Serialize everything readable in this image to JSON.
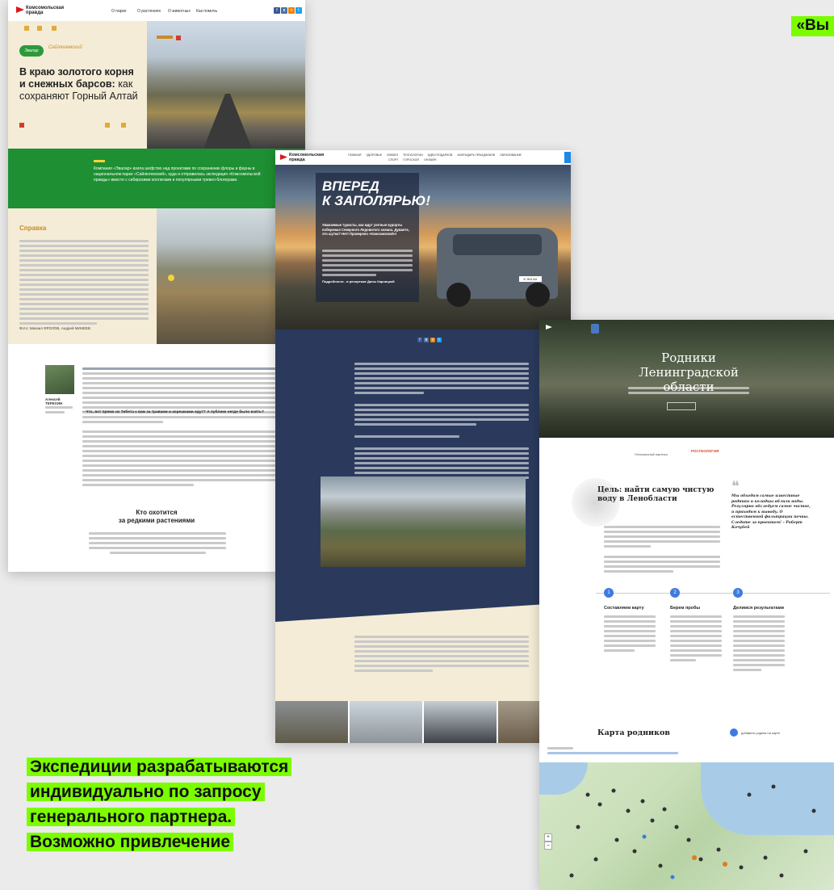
{
  "header_right": "«Вы",
  "bottom_left": {
    "lines": [
      "Экспедиции разрабатываются",
      "индивидуально по запросу",
      "генерального партнера.",
      "Возможно привлечение"
    ]
  },
  "card1": {
    "logo": "Комсомольская правда",
    "nav": [
      "О парке",
      "О растениях",
      "О животных",
      "Как помочь"
    ],
    "partner_logo_1": "Эвалар",
    "partner_logo_2": "Сайлюгемский",
    "headline_bold": "В краю золотого корня и снежных барсов:",
    "headline_light": "как сохраняют Горный Алтай",
    "green_text": "Компания «Эвалар» взяла шефство над проектами по сохранению флоры и фауны в национальном парке «Сайлюгемский», куда и отправилась экспедиция «Комсомольской правды» вместе с сибирскими коллегами и популярными тревел-блогерами.",
    "info_title": "Справка",
    "photo_credit": "Фото: Михаил ФРОЛОВ, Андрей МИНЕЕВ",
    "author_name": "Алексей ТЕРЕХИН",
    "quote_question": "– Что, вот прямо из Тибета к вам за травами и корешками едут? А публике негде было взять?",
    "section_title_1": "Кто охотится",
    "section_title_2": "за редкими растениями"
  },
  "card2": {
    "logo": "Комсомольская правда",
    "nav": [
      "ГЛАВНАЯ",
      "ЗДОРОВЬЕ",
      "ЛИКБЕЗ",
      "ТЕХНОЛОГИИ",
      "ИДЕИ ПОДАРКОВ",
      "КАЛЕНДАРЬ ПРАЗДНИКОВ",
      "ОБРАЗОВАНИЕ",
      "СПОРТ",
      "ГОРОСКОП",
      "ОНЛАЙН"
    ],
    "headline_1": "ВПЕРЕД",
    "headline_2": "К ЗАПОЛЯРЬЮ!",
    "lead": "Уважаемые туристы, как ждут уютные курорты побережья Северного Ледовитого океана. Думаете, это шутка? Нет! Проверено «Комсомолкой»!",
    "byline": "Подробности - в репортаже Дины Карницкой",
    "plate": "Е 904 АХ"
  },
  "card3": {
    "title": "Родники Ленинградской области",
    "partner_label": "Генеральный партнер",
    "partner_name": "РОСГЕОЛОГИЯ",
    "goal_title": "Цель: найти самую чистую воду в Ленобласти",
    "quote": "Мы обходим самые известные родники и колодцы вблизи воды. Регулярно обследуем самое чистое, и приходим к выводу. О естественной фильтрации почвы. Следите за проектом! – Роберт Кочубей",
    "steps": [
      {
        "num": "1",
        "title": "Составляем карту"
      },
      {
        "num": "2",
        "title": "Берем пробы"
      },
      {
        "num": "3",
        "title": "Делимся результатами"
      }
    ],
    "map_title": "Карта родников",
    "map_button": "добавить родник на карте",
    "map_zoom_in": "+",
    "map_zoom_out": "–"
  },
  "colors": {
    "highlight": "#7cfc00",
    "kp_red": "#d71920",
    "green_band": "#1e8f32",
    "navy": "#2b3a5c",
    "beige": "#f4ecd6",
    "step_blue": "#3e7be0"
  }
}
